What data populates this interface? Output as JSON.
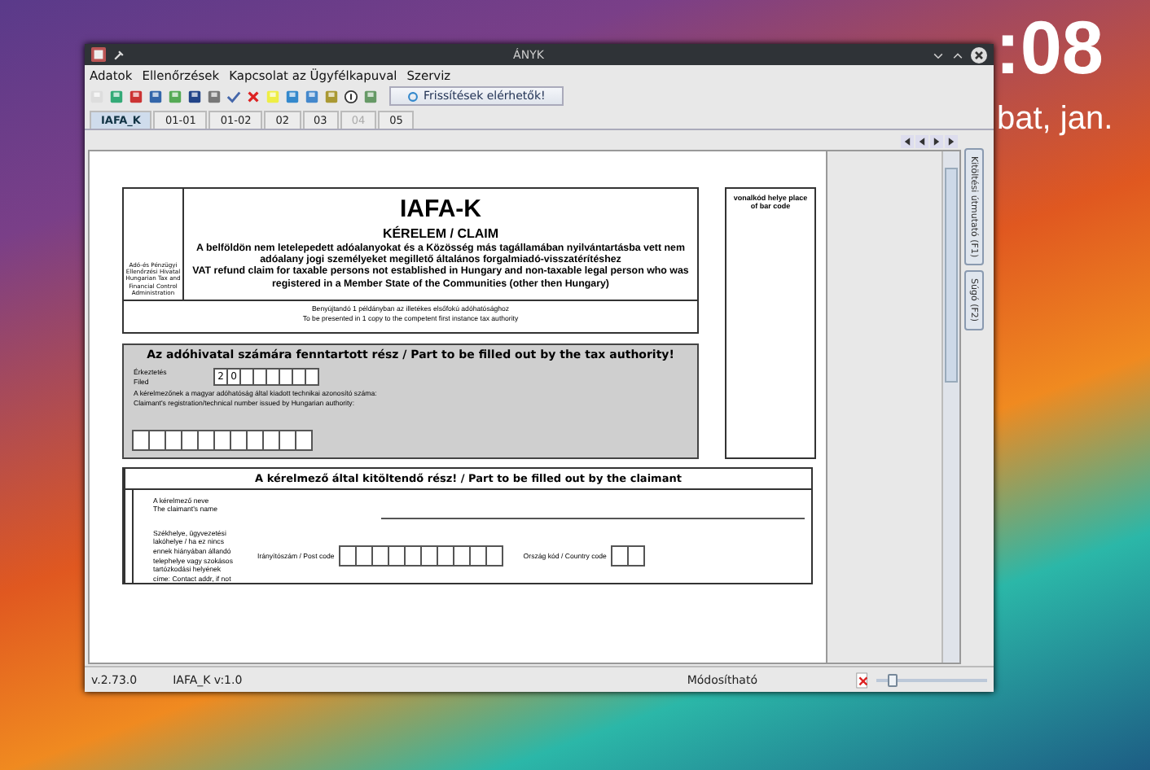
{
  "desktop": {
    "clock": ":08",
    "date": "bat, jan."
  },
  "window": {
    "title": "ÁNYK"
  },
  "menu": [
    "Adatok",
    "Ellenőrzések",
    "Kapcsolat az Ügyfélkapuval",
    "Szerviz"
  ],
  "toolbar": {
    "update_button": "Frissítések elérhetők!"
  },
  "tabs": [
    {
      "label": "IAFA_K",
      "selected": true,
      "disabled": false
    },
    {
      "label": "01-01",
      "selected": false,
      "disabled": false
    },
    {
      "label": "01-02",
      "selected": false,
      "disabled": false
    },
    {
      "label": "02",
      "selected": false,
      "disabled": false
    },
    {
      "label": "03",
      "selected": false,
      "disabled": false
    },
    {
      "label": "04",
      "selected": false,
      "disabled": true
    },
    {
      "label": "05",
      "selected": false,
      "disabled": false
    }
  ],
  "form": {
    "authority": "Adó-és Pénzügyi Ellenőrzési Hivatal Hungarian Tax and Financial Control Administration",
    "title": "IAFA-K",
    "subtitle": "KÉRELEM / CLAIM",
    "intro_hu": "A belföldön nem letelepedett adóalanyokat és a Közösség más tagállamában nyilvántartásba vett nem adóalany jogi személyeket megillető  általános forgalmiadó-visszatérítéshez",
    "intro_en": "VAT refund claim for taxable persons not established in Hungary and non-taxable legal person who was registered in a Member State of the Communities (other then Hungary)",
    "presented": [
      "Benyújtandó 1 példányban az illetékes elsőfokú adóhatósághoz",
      "To be presented in 1 copy to the competent first instance tax authority"
    ],
    "barcode_label": "vonalkód helye place of bar code",
    "tax_section": {
      "heading": "Az adóhivatal számára fenntartott rész / Part to be filled out by the tax authority!",
      "filed_label": [
        "Érkeztetés",
        "Filed"
      ],
      "filed_digits": [
        "2",
        "0"
      ],
      "registration_label": [
        "A kérelmezőnek a magyar adóhatóság által kiadott technikai azonosító száma:",
        "Claimant's registration/technical number issued by Hungarian authority:"
      ]
    },
    "claimant_section": {
      "heading": "A kérelmező által kitöltendő rész! / Part to be filled out by the claimant",
      "name_label": [
        "A kérelmező neve",
        "The claimant's name"
      ],
      "address_label": "Székhelye, ügyvezetési lakóhelye / ha ez nincs ennek hiányában állandó telephelye vagy szokásos tartózkodási helyének címe: Contact addr, if not",
      "postcode_label": "Irányítószám / Post code",
      "country_label": "Ország kód / Country code"
    }
  },
  "side_tabs": [
    "Kitöltési útmutató (F1)",
    "Súgó (F2)"
  ],
  "status_bar": {
    "version": "v.2.73.0",
    "form_version": "IAFA_K v:1.0",
    "mode": "Módosítható",
    "zoom": {
      "level": 0.15
    }
  }
}
